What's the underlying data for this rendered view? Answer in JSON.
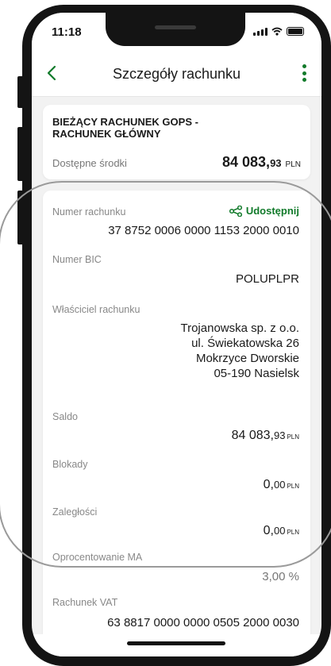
{
  "status_bar": {
    "time": "11:18"
  },
  "header": {
    "title": "Szczegóły rachunku",
    "back_icon": "chevron-left-icon",
    "menu_icon": "more-vertical-icon"
  },
  "account_card": {
    "name_line1": "BIEŻĄCY RACHUNEK GOPS -",
    "name_line2": "RACHUNEK GŁÓWNY",
    "available_label": "Dostępne środki",
    "available_int": "84 083,",
    "available_dec": "93",
    "available_currency": "PLN"
  },
  "details": {
    "account_number_label": "Numer rachunku",
    "share_label": "Udostępnij",
    "account_number": "37 8752 0006 0000 1153 2000 0010",
    "bic_label": "Numer BIC",
    "bic": "POLUPLPR",
    "owner_label": "Właściciel rachunku",
    "owner_lines": [
      "Trojanowska sp. z o.o.",
      "ul. Świekatowska 26",
      "Mokrzyce Dworskie",
      "05-190 Nasielsk"
    ],
    "balance_label": "Saldo",
    "balance_int": "84 083,",
    "balance_dec": "93",
    "blocks_label": "Blokady",
    "blocks_int": "0,",
    "blocks_dec": "00",
    "arrears_label": "Zaległości",
    "arrears_int": "0,",
    "arrears_dec": "00",
    "interest_label": "Oprocentowanie MA",
    "interest_value": "3,00 %",
    "vat_label": "Rachunek VAT",
    "vat_number": "63 8817 0000 0000 0505 2000 0030",
    "currency": "PLN"
  },
  "colors": {
    "brand_green": "#117a2a",
    "background": "#f2f2f2"
  }
}
